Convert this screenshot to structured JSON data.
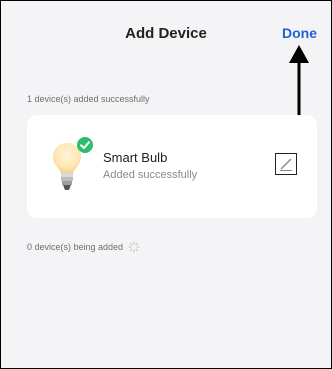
{
  "header": {
    "title": "Add Device",
    "done_label": "Done"
  },
  "added_section": {
    "label": "1 device(s) added successfully",
    "devices": [
      {
        "name": "Smart Bulb",
        "status": "Added successfully",
        "icon": "bulb-icon",
        "status_icon": "check-icon",
        "status_color": "#2dbd6e"
      }
    ]
  },
  "adding_section": {
    "label": "0 device(s) being added",
    "icon": "spinner-icon"
  },
  "colors": {
    "accent": "#1e63d6",
    "background": "#f4f4f6",
    "card": "#ffffff"
  }
}
